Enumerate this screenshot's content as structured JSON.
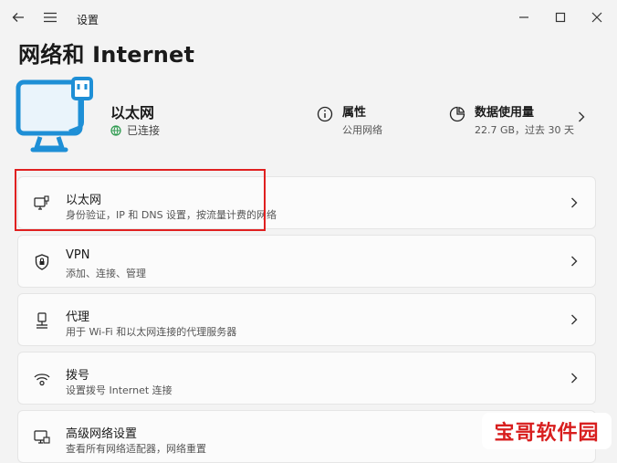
{
  "window": {
    "title": "设置"
  },
  "page": {
    "title": "网络和 Internet"
  },
  "connection": {
    "name": "以太网",
    "status": "已连接",
    "properties": {
      "title": "属性",
      "subtitle": "公用网络"
    },
    "data_usage": {
      "title": "数据使用量",
      "subtitle": "22.7 GB，过去 30 天"
    }
  },
  "items": [
    {
      "title": "以太网",
      "subtitle": "身份验证，IP 和 DNS 设置，按流量计费的网络",
      "icon": "ethernet-monitor-icon"
    },
    {
      "title": "VPN",
      "subtitle": "添加、连接、管理",
      "icon": "shield-icon"
    },
    {
      "title": "代理",
      "subtitle": "用于 Wi-Fi 和以太网连接的代理服务器",
      "icon": "proxy-icon"
    },
    {
      "title": "拨号",
      "subtitle": "设置拨号 Internet 连接",
      "icon": "dialup-icon"
    },
    {
      "title": "高级网络设置",
      "subtitle": "查看所有网络适配器，网络重置",
      "icon": "advanced-network-icon"
    }
  ],
  "watermark": "宝哥软件园",
  "colors": {
    "accent": "#1e8fd6",
    "status_green": "#2e9b4f",
    "highlight": "#e02020"
  }
}
